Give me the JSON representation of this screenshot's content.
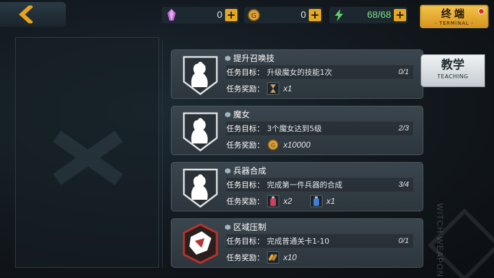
{
  "topbar": {
    "resources": [
      {
        "icon": "crystal-icon",
        "value": "0"
      },
      {
        "icon": "gold-coin-icon",
        "value": "0"
      },
      {
        "icon": "energy-icon",
        "value": "68/68"
      }
    ],
    "terminal": {
      "label": "终端",
      "sub": "- TERMINAL -"
    }
  },
  "tabs": {
    "teaching": {
      "label": "教学",
      "sub": "TEACHING"
    }
  },
  "quest_labels": {
    "goal": "任务目标：",
    "reward": "任务奖励："
  },
  "quests": [
    {
      "title": "提升召唤技",
      "goal": "升级魔女的技能1次",
      "progress": "0/1",
      "emblem": "witch-silhouette-icon",
      "rewards": [
        {
          "icon": "hourglass-item-icon",
          "qty": "x1"
        }
      ]
    },
    {
      "title": "魔女",
      "goal": "3个魔女达到5级",
      "progress": "2/3",
      "emblem": "witch-silhouette-icon",
      "rewards": [
        {
          "icon": "gold-coin-icon",
          "qty": "x10000"
        }
      ]
    },
    {
      "title": "兵器合成",
      "goal": "完成第一件兵器的合成",
      "progress": "3/4",
      "emblem": "witch-silhouette-icon",
      "rewards": [
        {
          "icon": "red-potion-icon",
          "qty": "x2"
        },
        {
          "icon": "blue-potion-icon",
          "qty": "x1"
        }
      ]
    },
    {
      "title": "区域压制",
      "goal": "完成普通关卡1-10",
      "progress": "0/1",
      "emblem": "battle-emblem-icon",
      "rewards": [
        {
          "icon": "ammo-item-icon",
          "qty": "x10"
        }
      ]
    }
  ],
  "watermark": "WITCH WEAPON",
  "colors": {
    "accent": "#e5a81f",
    "panel": "#343e45",
    "emblem_red": "#b8332b"
  }
}
